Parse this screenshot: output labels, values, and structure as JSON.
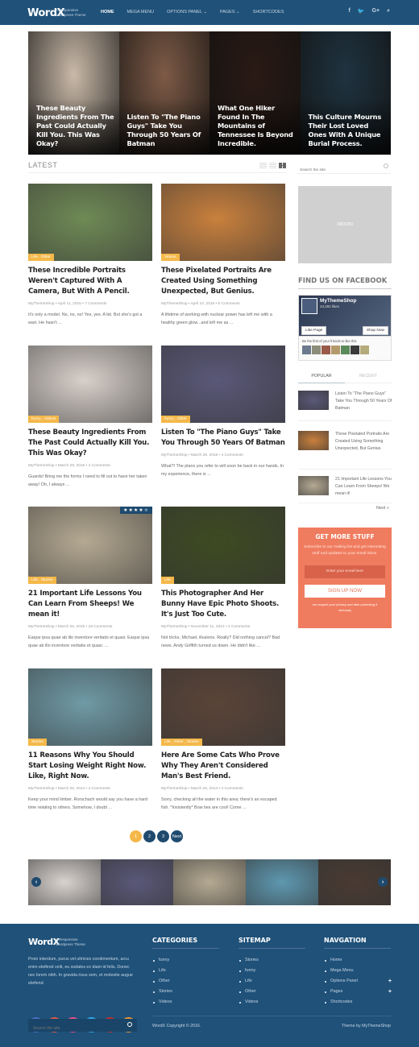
{
  "header": {
    "logo": "WordX",
    "tagline": "A Responsive Wordpress Theme",
    "nav": [
      {
        "label": "HOME",
        "active": true
      },
      {
        "label": "MEGA MENU"
      },
      {
        "label": "OPTIONS PANEL ⌄"
      },
      {
        "label": "PAGES ⌄"
      },
      {
        "label": "SHORTCODES"
      }
    ],
    "social": [
      "f",
      "🐦",
      "G+",
      "⌕"
    ]
  },
  "hero": [
    {
      "title": "These Beauty Ingredients From The Past Could Actually Kill You. This Was Okay?",
      "bg": "#c9b9a8"
    },
    {
      "title": "Listen To \"The Piano Guys\" Take You Through 50 Years Of Batman",
      "bg": "#7d5a46"
    },
    {
      "title": "What One Hiker Found In The Mountains of Tennessee Is Beyond Incredible.",
      "bg": "#2a1a14"
    },
    {
      "title": "This Culture Mourns Their Lost Loved Ones With A Unique Burial Process.",
      "bg": "#1f3340"
    }
  ],
  "latest": {
    "heading": "LATEST"
  },
  "posts": [
    {
      "cats": "Life , Other",
      "title": "These Incredible Portraits Weren't Captured With A Camera, But With A Pencil.",
      "meta": "MyThemeShop • April 11, 2015 • 7 Comments",
      "excerpt": "It's only a model. No, no, no! Yes, yes. A bit. But she's got a wart. He hasn't ...",
      "bg": "#6f8a55"
    },
    {
      "cats": "Videos",
      "title": "These Pixelated Portraits Are Created Using Something Unexpected, But Genius.",
      "meta": "MyThemeShop • April 10, 2015 • 5 Comments",
      "excerpt": "A lifetime of working with nuclear power has left me with a healthy green glow...and left me as ...",
      "bg": "#c9803d"
    },
    {
      "cats": "funny , Videos",
      "title": "These Beauty Ingredients From The Past Could Actually Kill You. This Was Okay?",
      "meta": "MyThemeShop • March 29, 2015 • 4 Comments",
      "excerpt": "Guards! Bring me the forms I need to fill out to have her taken away! Oh, I always ...",
      "bg": "#d8d0ca"
    },
    {
      "cats": "funny , Other",
      "title": "Listen To \"The Piano Guys\" Take You Through 50 Years Of Batman",
      "meta": "MyThemeShop • March 26, 2015 • 4 Comments",
      "excerpt": "What?! The plans you refer to will soon be back in our hands. In my experience, there is ...",
      "bg": "#5a5878"
    },
    {
      "cats": "Life , Stories",
      "title": "21 Important Life Lessons You Can Learn From Sheeps! We mean it!",
      "meta": "MyThemeShop • March 26, 2015 • 19 Comments",
      "excerpt": "Eaque ipsa quae ab illo inventore veritatis et quasi. Eaque ipsa quae ab illo inventore veritatis et quasi. ...",
      "bg": "#b5a992",
      "rating": 4,
      "rating_max": 5
    },
    {
      "cats": "Life",
      "title": "This Photographer And Her Bunny Have Epic Photo Shoots. It's Just Too Cute.",
      "meta": "MyThemeShop • November 11, 2014 • 4 Comments",
      "excerpt": "Not tricks, Michael, illusions. Really? Did nothing cancel? Bad news. Andy Griffith turned us down. He didn't like ...",
      "bg": "#3e4a22"
    },
    {
      "cats": "Stories",
      "title": "11 Reasons Why You Should Start Losing Weight Right Now. Like, Right Now.",
      "meta": "MyThemeShop • March 26, 2014 • 4 Comments",
      "excerpt": "Keep your mind limber. Rorschach would say you have a hard time relating to others. Somehow, I doubt ...",
      "bg": "#6f9aa6"
    },
    {
      "cats": "Life , Other , Stories",
      "title": "Here Are Some Cats Who Prove Why They Aren't Considered Man's Best Friend.",
      "meta": "MyThemeShop • March 26, 2014 • 4 Comments",
      "excerpt": "Sorry, checking all the water in this area; there's an escaped fish. *Insistently* Bow ties are cool! Come ...",
      "bg": "#5a4438"
    }
  ],
  "pagination": {
    "pages": [
      "1",
      "2",
      "3"
    ],
    "current": "1",
    "next": "Next"
  },
  "sidebar": {
    "search_placeholder": "Search the site",
    "ad_label": "300X250",
    "facebook": {
      "title": "FIND US ON FACEBOOK",
      "page_name": "MyThemeShop",
      "likes": "43,292 likes",
      "like_btn": "Like Page",
      "shop_btn": "Shop Now",
      "friends_text": "Be the first of your friends to like this"
    },
    "tabs": [
      {
        "label": "POPULAR",
        "active": true
      },
      {
        "label": "RECENT"
      }
    ],
    "popular": [
      {
        "title": "Listen To \"The Piano Guys\" Take You Through 50 Years Of Batman",
        "bg": "#5a5878"
      },
      {
        "title": "These Pixelated Portraits Are Created Using Something Unexpected, But Genius.",
        "bg": "#c9803d"
      },
      {
        "title": "21 Important Life Lessons You Can Learn From Sheeps! We mean it!",
        "bg": "#b5a992"
      }
    ],
    "next_label": "Next »",
    "newsletter": {
      "title": "GET MORE STUFF",
      "text": "Subscribe to our mailing list and get interesting stuff and updates to your email inbox.",
      "placeholder": "Enter your email here",
      "button": "SIGN UP NOW",
      "privacy": "we respect your privacy and take protecting it seriously",
      "bg": "#f07c5f"
    }
  },
  "carousel": {
    "slides": [
      "#d9d3cf",
      "#5a5878",
      "#b5a992",
      "#5e98b0",
      "#4a3a32"
    ],
    "prev": "‹",
    "next": "›"
  },
  "footer": {
    "logo": "WordX",
    "tagline": "A Responsive Wordpress Theme",
    "about": "Proin interdum, purus vel ultricies condimentum, arcu enim eleifend velit, eu sodales ex diam id felis. Donec nec lorem nibh. In gravida risus sem, et molestie augue eleifend.",
    "social": [
      {
        "icon": "f",
        "color": "#4a6fc4"
      },
      {
        "icon": "G+",
        "color": "#e05a47"
      },
      {
        "icon": "✿",
        "color": "#ea4c89"
      },
      {
        "icon": "🐦",
        "color": "#2ea8e6"
      },
      {
        "icon": "▶",
        "color": "#c4302b"
      },
      {
        "icon": "◉",
        "color": "#f09430"
      }
    ],
    "search_placeholder": "Search the site",
    "categories": {
      "title": "CATEGORIES",
      "items": [
        "funny",
        "Life",
        "Other",
        "Stories",
        "Videos"
      ]
    },
    "sitemap": {
      "title": "SITEMAP",
      "items": [
        "Stories",
        "funny",
        "Life",
        "Other",
        "Videos"
      ]
    },
    "navigation": {
      "title": "NAVGATION",
      "items": [
        {
          "label": "Home"
        },
        {
          "label": "Mega Menu"
        },
        {
          "label": "Options Panel",
          "expand": true
        },
        {
          "label": "Pages",
          "expand": true
        },
        {
          "label": "Shortcodes"
        }
      ]
    },
    "copyright": "WordX Copyright © 2016.",
    "theme_by": "Theme by MyThemeShop"
  }
}
